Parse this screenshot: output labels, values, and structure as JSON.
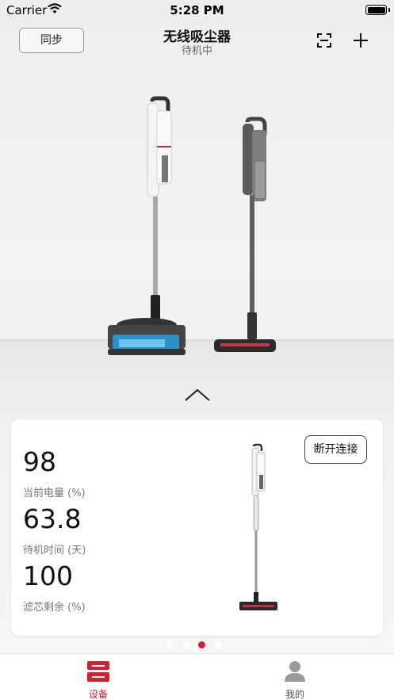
{
  "status_bar": {
    "carrier": "Carrier",
    "time": "5:28 PM"
  },
  "nav": {
    "sync_label": "同步",
    "title": "无线吸尘器",
    "subtitle": "待机中"
  },
  "card": {
    "disconnect_label": "断开连接",
    "metrics": [
      {
        "value": "98",
        "label": "当前电量 (%)"
      },
      {
        "value": "63.8",
        "label": "待机时间 (天)"
      },
      {
        "value": "100",
        "label": "滤芯剩余 (%)"
      }
    ]
  },
  "pager": {
    "count": 4,
    "active_index": 2
  },
  "tabs": [
    {
      "label": "设备",
      "active": true
    },
    {
      "label": "我的",
      "active": false
    }
  ],
  "colors": {
    "accent": "#d0212e",
    "inactive": "#555555"
  }
}
